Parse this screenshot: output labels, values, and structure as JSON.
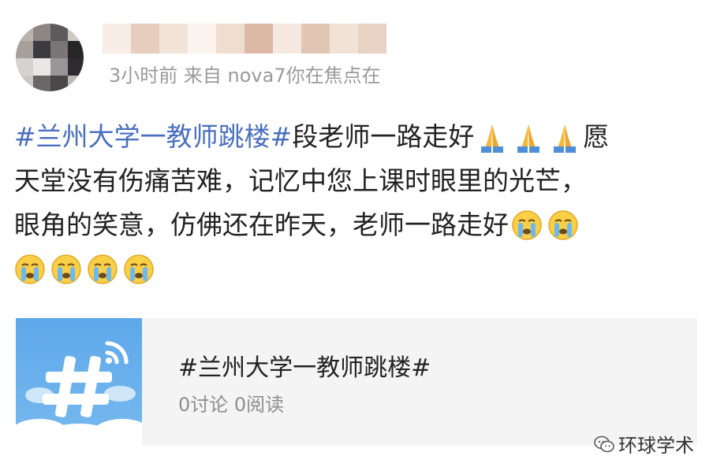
{
  "header": {
    "meta": "3小时前  来自 nova7你在焦点在"
  },
  "post": {
    "line1": {
      "hashtag": "#兰州大学一教师跳楼#",
      "text": "段老师一路走好",
      "tail": "愿"
    },
    "line2": "天堂没有伤痛苦难，记忆中您上课时眼里的光芒，",
    "line3": "眼角的笑意，仿佛还在昨天，老师一路走好",
    "icons": [
      "folded-hands-icon",
      "crying-face-icon"
    ]
  },
  "card": {
    "title": "#兰州大学一教师跳楼#",
    "stats": "0讨论 0阅读"
  },
  "watermark": {
    "text": "环球学术"
  },
  "colors": {
    "hashtag": "#4a6fbf",
    "meta": "#9a9a9a",
    "card_bg": "#f4f4f4",
    "thumb": "#5ea8ea"
  }
}
